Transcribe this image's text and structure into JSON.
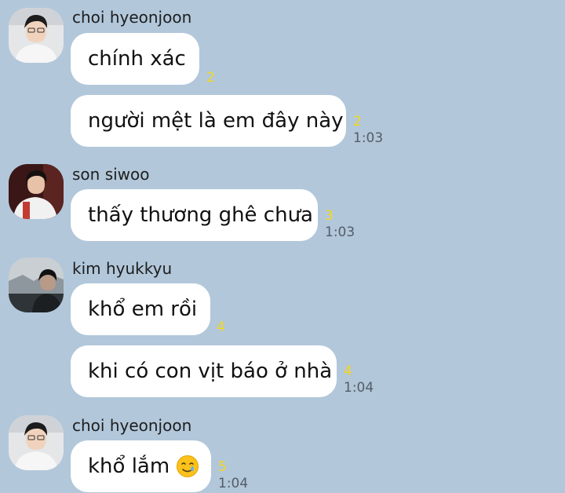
{
  "chat": {
    "background_color": "#b2c7da",
    "unread_color": "#f5d71c",
    "groups": [
      {
        "sender": "choi hyeonjoon",
        "avatar": "avatar-choi-hyeonjoon",
        "messages": [
          {
            "text": "chính xác",
            "unread": "2",
            "time": ""
          },
          {
            "text": "người mệt là em đây này",
            "unread": "2",
            "time": "1:03"
          }
        ]
      },
      {
        "sender": "son siwoo",
        "avatar": "avatar-son-siwoo",
        "messages": [
          {
            "text": "thấy thương ghê chưa",
            "unread": "3",
            "time": "1:03"
          }
        ]
      },
      {
        "sender": "kim hyukkyu",
        "avatar": "avatar-kim-hyukkyu",
        "messages": [
          {
            "text": "khổ em rồi",
            "unread": "4",
            "time": ""
          },
          {
            "text": "khi có con vịt báo ở nhà",
            "unread": "4",
            "time": "1:04"
          }
        ]
      },
      {
        "sender": "choi hyeonjoon",
        "avatar": "avatar-choi-hyeonjoon",
        "messages": [
          {
            "text": "khổ lắm",
            "emoji": "crying-smile-emoji",
            "unread": "5",
            "time": "1:04"
          }
        ]
      }
    ]
  }
}
